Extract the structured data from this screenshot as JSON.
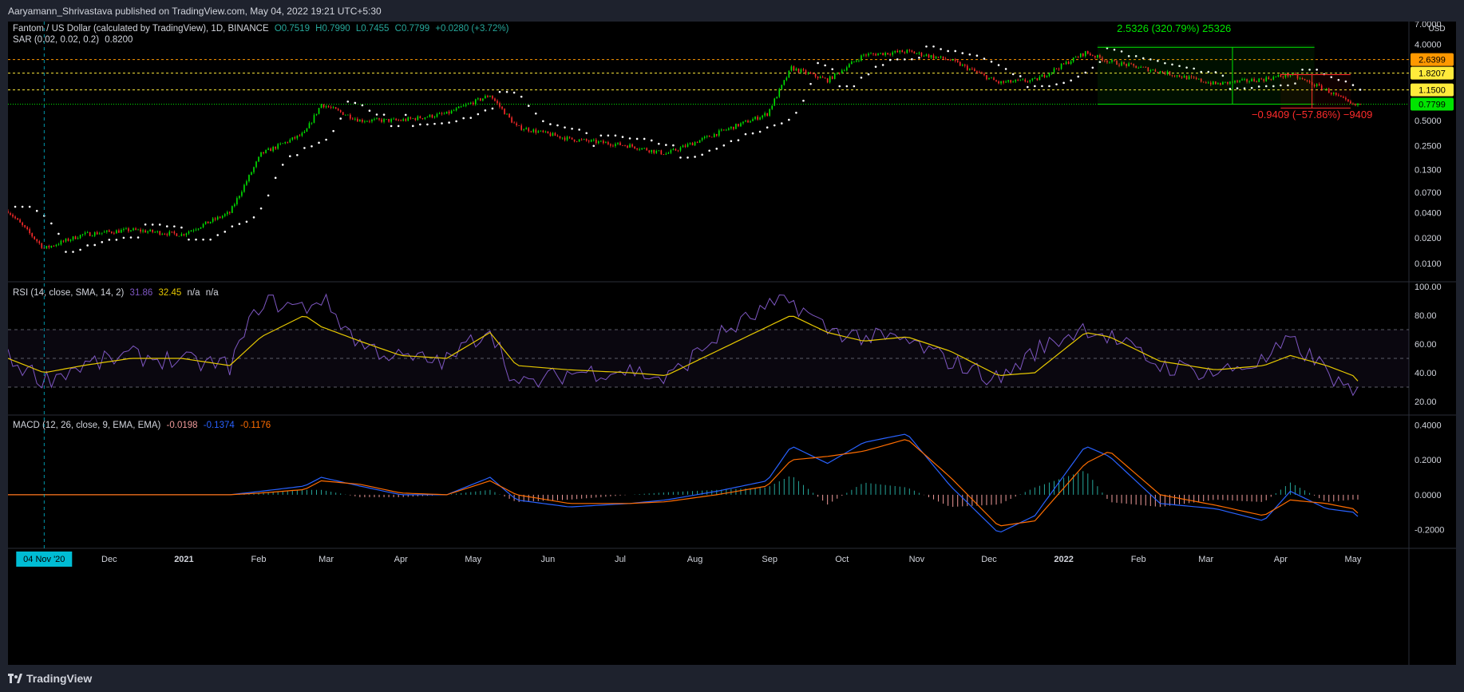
{
  "publisher_line": "Aaryamann_Shrivastava published on TradingView.com, May 04, 2022 19:21 UTC+5:30",
  "footer_brand": "TradingView",
  "colors": {
    "up": "#26a69a",
    "up_candle": "#00e400",
    "down": "#ff2b2b",
    "rsi": "#7e57c2",
    "rsi_ma": "#e6c800",
    "macd": "#2962ff",
    "signal": "#ff6d00",
    "target_green": "#00e400",
    "target_red": "#ff2b2b"
  },
  "legends": {
    "main": {
      "name": "Fantom / US Dollar (calculated by TradingView), 1D, BINANCE",
      "o": "O0.7519",
      "h": "H0.7990",
      "l": "L0.7455",
      "c": "C0.7799",
      "chg": "+0.0280 (+3.72%)"
    },
    "sar": {
      "name": "SAR (0.02, 0.02, 0.2)",
      "value": "0.8200"
    },
    "rsi": {
      "name": "RSI (14, close, SMA, 14, 2)",
      "v1": "31.86",
      "v2": "32.45",
      "v3": "n/a",
      "v4": "n/a"
    },
    "macd": {
      "name": "MACD (12, 26, close, 9, EMA, EMA)",
      "hist": "-0.0198",
      "macd": "-0.1374",
      "signal": "-0.1176"
    }
  },
  "chart_data": [
    {
      "type": "candlestick",
      "title": "Fantom / US Dollar",
      "y_scale": "log",
      "y_axis_unit": "USD",
      "y_ticks": [
        "7.0000",
        "4.0000",
        "0.5000",
        "0.2500",
        "0.1300",
        "0.0700",
        "0.0400",
        "0.0200",
        "0.0100"
      ],
      "x_ticks": [
        "Dec",
        "2021",
        "Feb",
        "Mar",
        "Apr",
        "May",
        "Jun",
        "Jul",
        "Aug",
        "Sep",
        "Oct",
        "Nov",
        "Dec",
        "2022",
        "Feb",
        "Mar",
        "Apr",
        "May"
      ],
      "crosshair_date": "04 Nov '20",
      "close_series": {
        "dates": [
          "2020-10-20",
          "2020-11-04",
          "2020-11-20",
          "2020-12-10",
          "2020-12-31",
          "2021-01-20",
          "2021-02-02",
          "2021-02-20",
          "2021-02-27",
          "2021-03-15",
          "2021-04-01",
          "2021-04-20",
          "2021-05-08",
          "2021-05-19",
          "2021-06-10",
          "2021-07-05",
          "2021-07-20",
          "2021-08-10",
          "2021-08-31",
          "2021-09-10",
          "2021-09-25",
          "2021-10-10",
          "2021-10-28",
          "2021-11-15",
          "2021-12-05",
          "2021-12-20",
          "2022-01-10",
          "2022-01-20",
          "2022-02-10",
          "2022-03-05",
          "2022-03-25",
          "2022-04-05",
          "2022-04-20",
          "2022-05-01",
          "2022-05-04"
        ],
        "values": [
          0.042,
          0.015,
          0.022,
          0.025,
          0.022,
          0.04,
          0.2,
          0.35,
          0.78,
          0.5,
          0.5,
          0.6,
          1.0,
          0.42,
          0.3,
          0.25,
          0.2,
          0.35,
          0.6,
          2.1,
          1.5,
          3.0,
          3.3,
          2.6,
          1.4,
          1.5,
          3.2,
          2.5,
          1.9,
          1.35,
          1.55,
          1.75,
          1.15,
          0.75,
          0.7799
        ]
      },
      "price_labels": [
        {
          "value": "2.6399",
          "color": "#ff9800"
        },
        {
          "value": "1.8207",
          "color": "#ffeb3b"
        },
        {
          "value": "1.1500",
          "color": "#ffeb3b"
        },
        {
          "value": "0.7799",
          "color": "#00e400"
        }
      ],
      "horizontal_levels": [
        2.6399,
        1.8207,
        1.15,
        0.7799
      ],
      "annotations": [
        {
          "text": "2.5326 (320.79%) 25326",
          "color": "#00e400"
        },
        {
          "text": "−0.9409 (−57.86%) −9409",
          "color": "#ff2b2b"
        }
      ],
      "overlay": {
        "name": "SAR",
        "last_value": 0.82
      }
    },
    {
      "type": "line",
      "title": "RSI (14, close, SMA, 14, 2)",
      "y_ticks": [
        "100.00",
        "80.00",
        "60.00",
        "40.00",
        "20.00"
      ],
      "bands": [
        70,
        50,
        30
      ],
      "rsi": [
        50,
        35,
        45,
        52,
        48,
        45,
        90,
        85,
        92,
        60,
        50,
        48,
        72,
        30,
        40,
        42,
        35,
        65,
        85,
        90,
        70,
        65,
        62,
        48,
        35,
        55,
        72,
        65,
        45,
        40,
        48,
        62,
        42,
        22,
        31.86
      ],
      "rsi_ma": [
        50,
        40,
        45,
        50,
        50,
        45,
        65,
        80,
        72,
        62,
        52,
        50,
        68,
        45,
        42,
        40,
        38,
        55,
        72,
        80,
        68,
        62,
        65,
        55,
        38,
        40,
        68,
        65,
        48,
        42,
        45,
        52,
        45,
        38,
        32.45
      ]
    },
    {
      "type": "line",
      "title": "MACD (12, 26, close, 9, EMA, EMA)",
      "y_ticks": [
        "0.4000",
        "0.2000",
        "0.0000",
        "-0.2000"
      ],
      "macd": [
        0.0,
        0.0,
        0.0,
        0.0,
        0.0,
        0.0,
        0.02,
        0.05,
        0.1,
        0.05,
        0.0,
        0.0,
        0.1,
        -0.03,
        -0.07,
        -0.05,
        -0.03,
        0.02,
        0.08,
        0.28,
        0.18,
        0.3,
        0.35,
        0.05,
        -0.22,
        -0.12,
        0.28,
        0.22,
        -0.05,
        -0.08,
        -0.15,
        0.02,
        -0.08,
        -0.1,
        -0.1374
      ],
      "signal": [
        0.0,
        0.0,
        0.0,
        0.0,
        0.0,
        0.0,
        0.01,
        0.03,
        0.08,
        0.06,
        0.01,
        0.0,
        0.08,
        0.0,
        -0.05,
        -0.05,
        -0.04,
        0.0,
        0.05,
        0.2,
        0.22,
        0.25,
        0.32,
        0.1,
        -0.18,
        -0.15,
        0.18,
        0.25,
        0.0,
        -0.06,
        -0.12,
        -0.03,
        -0.05,
        -0.08,
        -0.1176
      ]
    }
  ]
}
